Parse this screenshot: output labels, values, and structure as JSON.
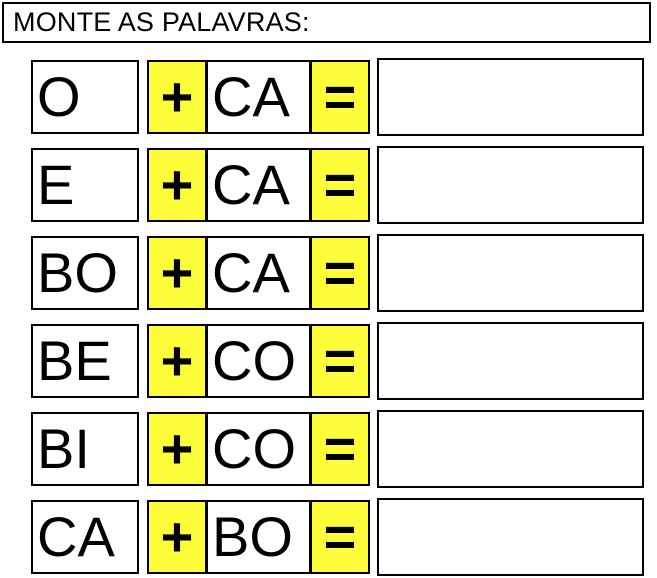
{
  "worksheet": {
    "title": "MONTE AS PALAVRAS:",
    "plus_symbol": "+",
    "equals_symbol": "=",
    "colors": {
      "operator_highlight": "#FDFD3A",
      "border": "#000000",
      "text": "#000000",
      "background": "#FFFFFF"
    },
    "rows": [
      {
        "syllable_1": "O",
        "operator": "+",
        "syllable_2": "CA",
        "equals": "=",
        "answer": ""
      },
      {
        "syllable_1": "E",
        "operator": "+",
        "syllable_2": "CA",
        "equals": "=",
        "answer": ""
      },
      {
        "syllable_1": "BO",
        "operator": "+",
        "syllable_2": "CA",
        "equals": "=",
        "answer": ""
      },
      {
        "syllable_1": "BE",
        "operator": "+",
        "syllable_2": "CO",
        "equals": "=",
        "answer": ""
      },
      {
        "syllable_1": "BI",
        "operator": "+",
        "syllable_2": "CO",
        "equals": "=",
        "answer": ""
      },
      {
        "syllable_1": "CA",
        "operator": "+",
        "syllable_2": "BO",
        "equals": "=",
        "answer": ""
      }
    ]
  }
}
